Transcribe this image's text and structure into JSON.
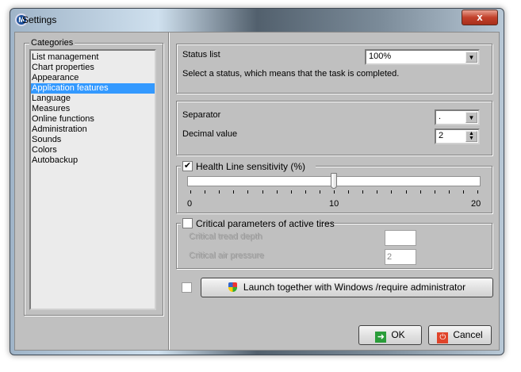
{
  "window": {
    "title": "Settings",
    "close_label": "x"
  },
  "categories": {
    "label": "Categories",
    "items": [
      "List management",
      "Chart properties",
      "Appearance",
      "Application features",
      "Language",
      "Measures",
      "Online functions",
      "Administration",
      "Sounds",
      "Colors",
      "Autobackup"
    ],
    "selected_index": 3,
    "selection_color": "#3399ff"
  },
  "status": {
    "label": "Status list",
    "value": "100%",
    "hint": "Select a status, which means that the task is completed."
  },
  "number": {
    "separator_label": "Separator",
    "separator_value": ".",
    "decimal_label": "Decimal value",
    "decimal_value": "2"
  },
  "health": {
    "label": "Health Line sensitivity (%)",
    "checked": true,
    "min": 0,
    "max": 20,
    "value": 10,
    "tick_labels": [
      "0",
      "10",
      "20"
    ]
  },
  "tires": {
    "label": "Critical parameters of active tires",
    "checked": false,
    "tread_label": "Critical tread depth",
    "tread_value": "",
    "pressure_label": "Critical air pressure",
    "pressure_value": "2"
  },
  "launch": {
    "checked": false,
    "label": "Launch together with Windows /require administrator",
    "icon": "uac-shield-icon"
  },
  "buttons": {
    "ok": "OK",
    "cancel": "Cancel"
  }
}
